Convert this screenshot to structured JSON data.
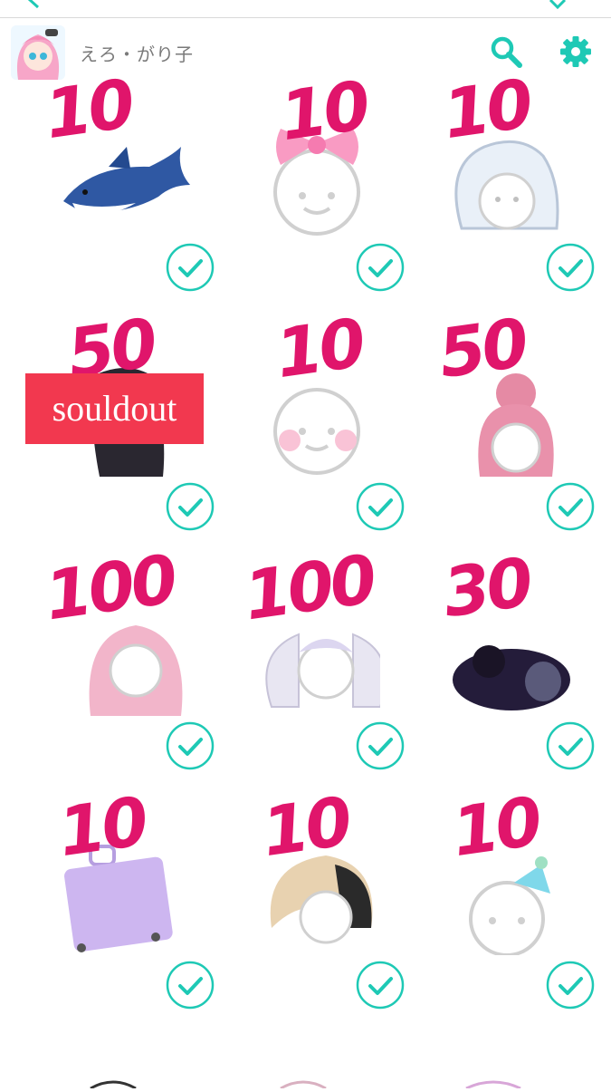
{
  "header": {
    "username": "えろ・がり子"
  },
  "items": [
    {
      "price": "10",
      "art": "shark"
    },
    {
      "price": "10",
      "art": "bow"
    },
    {
      "price": "10",
      "art": "seal-hat"
    },
    {
      "price": "50",
      "art": "dark-hair"
    },
    {
      "price": "10",
      "art": "blush-face"
    },
    {
      "price": "50",
      "art": "bun-hair"
    },
    {
      "price": "100",
      "art": "pink-long-hair"
    },
    {
      "price": "100",
      "art": "twin-tails"
    },
    {
      "price": "30",
      "art": "dark-creature"
    },
    {
      "price": "10",
      "art": "suitcase"
    },
    {
      "price": "10",
      "art": "blonde-hair"
    },
    {
      "price": "10",
      "art": "party-hat"
    }
  ],
  "soldout_label": "souldout",
  "colors": {
    "accent": "#1ec9b5",
    "price_marker": "#e0156b",
    "soldout_bg": "#f2384f",
    "username": "#7a7a7a"
  },
  "icons": [
    "back-icon",
    "share-icon",
    "search-icon",
    "gear-icon",
    "check-icon"
  ]
}
